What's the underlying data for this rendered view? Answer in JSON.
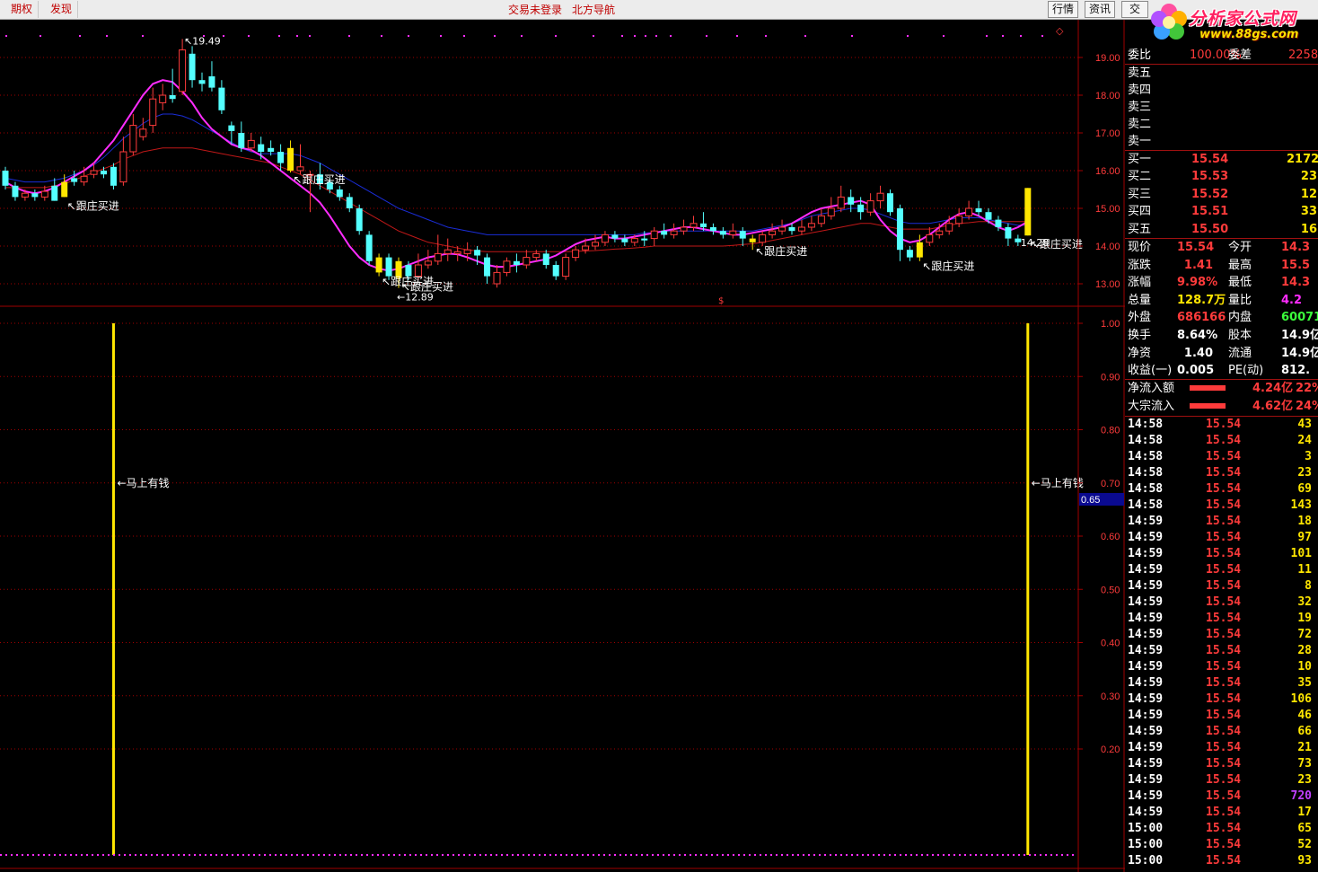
{
  "toolbar": {
    "left_tabs": [
      "期权",
      "发现"
    ],
    "center_links": [
      "交易未登录",
      "北方导航"
    ],
    "right_buttons": [
      "行情",
      "资讯",
      "交"
    ]
  },
  "logo": {
    "title": "分析家公式网",
    "url": "www.88gs.com"
  },
  "colors": {
    "up": "#ff3b3b",
    "down": "#54ffff",
    "signal": "#ffe600",
    "ma_short": "#ff2cff",
    "ma_mid": "#1a2dd8",
    "ma_long": "#c01818",
    "grid": "#a00000"
  },
  "price_axis": {
    "labels": [
      "19.00",
      "18.00",
      "17.00",
      "16.00",
      "15.00",
      "14.00",
      "13.00"
    ]
  },
  "indicator_axis": {
    "labels": [
      "1.00",
      "0.90",
      "0.80",
      "0.70",
      "0.60",
      "0.50",
      "0.40",
      "0.30",
      "0.20"
    ],
    "current_value": "0.65"
  },
  "chart_data": {
    "type": "candlestick",
    "high_label": "19.49",
    "low_label": "12.89",
    "last_label": "14.28",
    "signal_text": "跟庄买进",
    "indicator_text": "马上有钱",
    "candles": [
      [
        16.0,
        15.6,
        16.1,
        15.5
      ],
      [
        15.6,
        15.3,
        15.7,
        15.2
      ],
      [
        15.3,
        15.4,
        15.5,
        15.2
      ],
      [
        15.4,
        15.3,
        15.5,
        15.2
      ],
      [
        15.3,
        15.45,
        15.6,
        15.2
      ],
      [
        15.6,
        15.2,
        15.8,
        15.2
      ],
      [
        15.3,
        15.7,
        15.9,
        15.3
      ],
      [
        15.8,
        15.7,
        16.0,
        15.6
      ],
      [
        15.7,
        15.85,
        16.1,
        15.6
      ],
      [
        15.9,
        16.0,
        16.2,
        15.8
      ],
      [
        16.0,
        15.9,
        16.1,
        15.8
      ],
      [
        16.1,
        15.6,
        16.2,
        15.5
      ],
      [
        15.7,
        16.5,
        16.9,
        15.6
      ],
      [
        16.5,
        17.2,
        17.5,
        16.4
      ],
      [
        16.9,
        17.1,
        17.4,
        16.8
      ],
      [
        17.2,
        17.9,
        18.2,
        17.0
      ],
      [
        17.8,
        18.0,
        18.3,
        17.6
      ],
      [
        18.0,
        17.9,
        18.7,
        17.8
      ],
      [
        18.1,
        19.2,
        19.49,
        18.0
      ],
      [
        19.1,
        18.4,
        19.3,
        18.2
      ],
      [
        18.4,
        18.3,
        18.6,
        18.1
      ],
      [
        18.5,
        18.2,
        18.9,
        18.1
      ],
      [
        18.2,
        17.6,
        18.4,
        17.5
      ],
      [
        17.2,
        17.05,
        17.3,
        16.7
      ],
      [
        17.0,
        16.6,
        17.3,
        16.5
      ],
      [
        16.6,
        16.8,
        17.0,
        16.5
      ],
      [
        16.7,
        16.5,
        16.9,
        16.3
      ],
      [
        16.6,
        16.5,
        16.8,
        16.4
      ],
      [
        16.5,
        16.2,
        16.7,
        16.0
      ],
      [
        16.6,
        16.0,
        16.8,
        15.95
      ],
      [
        16.0,
        16.1,
        16.7,
        15.9
      ],
      [
        15.9,
        15.9,
        16.0,
        14.9
      ],
      [
        15.9,
        15.65,
        16.2,
        15.5
      ],
      [
        15.7,
        15.5,
        15.8,
        15.4
      ],
      [
        15.5,
        15.3,
        15.6,
        15.2
      ],
      [
        15.3,
        15.0,
        15.4,
        14.9
      ],
      [
        15.0,
        14.4,
        15.1,
        14.3
      ],
      [
        14.3,
        13.6,
        14.4,
        13.5
      ],
      [
        13.7,
        13.3,
        13.8,
        13.2
      ],
      [
        13.7,
        13.2,
        13.8,
        13.1
      ],
      [
        13.6,
        13.15,
        13.7,
        12.89
      ],
      [
        13.5,
        13.2,
        13.6,
        13.1
      ],
      [
        13.2,
        13.5,
        13.8,
        13.1
      ],
      [
        13.5,
        13.6,
        13.9,
        13.4
      ],
      [
        13.6,
        13.8,
        14.3,
        13.5
      ],
      [
        13.8,
        13.9,
        14.2,
        13.6
      ],
      [
        13.8,
        13.85,
        14.0,
        13.6
      ],
      [
        13.8,
        13.9,
        14.1,
        13.6
      ],
      [
        13.9,
        13.75,
        14.0,
        13.5
      ],
      [
        13.7,
        13.2,
        13.8,
        13.0
      ],
      [
        13.0,
        13.3,
        13.5,
        12.9
      ],
      [
        13.3,
        13.6,
        13.7,
        13.2
      ],
      [
        13.6,
        13.5,
        13.8,
        13.3
      ],
      [
        13.5,
        13.7,
        13.9,
        13.4
      ],
      [
        13.7,
        13.8,
        13.9,
        13.6
      ],
      [
        13.8,
        13.5,
        13.9,
        13.4
      ],
      [
        13.5,
        13.2,
        13.6,
        13.1
      ],
      [
        13.2,
        13.7,
        13.8,
        13.1
      ],
      [
        13.7,
        13.9,
        14.0,
        13.6
      ],
      [
        13.9,
        14.0,
        14.2,
        13.8
      ],
      [
        14.0,
        14.1,
        14.3,
        13.9
      ],
      [
        14.1,
        14.3,
        14.4,
        14.0
      ],
      [
        14.3,
        14.2,
        14.4,
        14.1
      ],
      [
        14.2,
        14.1,
        14.3,
        14.0
      ],
      [
        14.1,
        14.2,
        14.3,
        14.0
      ],
      [
        14.2,
        14.15,
        14.4,
        14.0
      ],
      [
        14.2,
        14.4,
        14.5,
        14.0
      ],
      [
        14.4,
        14.3,
        14.6,
        14.2
      ],
      [
        14.3,
        14.4,
        14.6,
        14.2
      ],
      [
        14.4,
        14.5,
        14.7,
        14.3
      ],
      [
        14.5,
        14.6,
        14.8,
        14.4
      ],
      [
        14.6,
        14.5,
        14.9,
        14.4
      ],
      [
        14.5,
        14.4,
        14.6,
        14.3
      ],
      [
        14.4,
        14.3,
        14.5,
        14.2
      ],
      [
        14.3,
        14.4,
        14.6,
        14.2
      ],
      [
        14.4,
        14.2,
        14.5,
        14.0
      ],
      [
        14.2,
        14.1,
        14.3,
        13.9
      ],
      [
        14.1,
        14.3,
        14.4,
        14.0
      ],
      [
        14.3,
        14.4,
        14.6,
        14.2
      ],
      [
        14.4,
        14.5,
        14.7,
        14.3
      ],
      [
        14.5,
        14.4,
        14.6,
        14.3
      ],
      [
        14.4,
        14.5,
        14.7,
        14.3
      ],
      [
        14.5,
        14.6,
        14.8,
        14.4
      ],
      [
        14.6,
        14.8,
        15.0,
        14.5
      ],
      [
        14.8,
        15.0,
        15.3,
        14.7
      ],
      [
        15.0,
        15.3,
        15.6,
        14.9
      ],
      [
        15.3,
        15.1,
        15.5,
        14.9
      ],
      [
        15.1,
        14.9,
        15.3,
        14.7
      ],
      [
        14.9,
        15.2,
        15.4,
        14.8
      ],
      [
        15.2,
        15.4,
        15.6,
        15.0
      ],
      [
        15.4,
        14.9,
        15.5,
        14.8
      ],
      [
        15.0,
        13.9,
        15.1,
        13.6
      ],
      [
        13.9,
        13.7,
        14.0,
        13.6
      ],
      [
        13.7,
        14.1,
        14.3,
        13.6
      ],
      [
        14.1,
        14.3,
        14.5,
        14.0
      ],
      [
        14.3,
        14.4,
        14.6,
        14.2
      ],
      [
        14.4,
        14.6,
        14.8,
        14.3
      ],
      [
        14.6,
        14.8,
        15.0,
        14.5
      ],
      [
        14.8,
        15.0,
        15.2,
        14.7
      ],
      [
        15.0,
        14.9,
        15.2,
        14.8
      ],
      [
        14.9,
        14.7,
        15.0,
        14.6
      ],
      [
        14.7,
        14.5,
        14.8,
        14.4
      ],
      [
        14.5,
        14.2,
        14.6,
        14.0
      ],
      [
        14.2,
        14.1,
        14.3,
        14.0
      ],
      [
        14.28,
        15.54,
        15.54,
        14.28
      ]
    ],
    "ma_short": [
      15.7,
      15.55,
      15.45,
      15.4,
      15.45,
      15.55,
      15.7,
      15.85,
      16.0,
      16.2,
      16.5,
      16.8,
      17.2,
      17.6,
      18.0,
      18.3,
      18.4,
      18.35,
      18.1,
      17.8,
      17.4,
      17.1,
      16.9,
      16.7,
      16.6,
      16.55,
      16.4,
      16.2,
      16.0,
      15.8,
      15.6,
      15.4,
      15.15,
      14.8,
      14.4,
      14.0,
      13.7,
      13.5,
      13.4,
      13.35,
      13.4,
      13.5,
      13.6,
      13.7,
      13.75,
      13.8,
      13.78,
      13.7,
      13.6,
      13.5,
      13.45,
      13.45,
      13.5,
      13.55,
      13.6,
      13.65,
      13.75,
      13.9,
      14.05,
      14.15,
      14.2,
      14.25,
      14.2,
      14.2,
      14.25,
      14.3,
      14.35,
      14.4,
      14.45,
      14.5,
      14.5,
      14.45,
      14.4,
      14.35,
      14.3,
      14.3,
      14.35,
      14.4,
      14.45,
      14.5,
      14.6,
      14.75,
      14.9,
      15.0,
      15.05,
      15.1,
      15.15,
      15.2,
      15.1,
      14.7,
      14.4,
      14.2,
      14.1,
      14.15,
      14.3,
      14.5,
      14.7,
      14.85,
      14.9,
      14.8,
      14.65,
      14.5,
      14.4,
      14.5,
      14.65
    ],
    "ma_mid": [
      15.8,
      15.75,
      15.7,
      15.7,
      15.7,
      15.75,
      15.8,
      15.9,
      16.0,
      16.15,
      16.35,
      16.6,
      16.85,
      17.05,
      17.25,
      17.4,
      17.5,
      17.5,
      17.45,
      17.35,
      17.2,
      17.05,
      16.9,
      16.75,
      16.6,
      16.5,
      16.45,
      16.45,
      16.45,
      16.45,
      16.4,
      16.3,
      16.2,
      16.05,
      15.9,
      15.75,
      15.6,
      15.45,
      15.3,
      15.15,
      15.0,
      14.9,
      14.8,
      14.7,
      14.6,
      14.5,
      14.45,
      14.4,
      14.35,
      14.3,
      14.3,
      14.3,
      14.3,
      14.3,
      14.3,
      14.3,
      14.3,
      14.3,
      14.3,
      14.3,
      14.3,
      14.3,
      14.3,
      14.3,
      14.3,
      14.35,
      14.35,
      14.4,
      14.4,
      14.4,
      14.4,
      14.4,
      14.4,
      14.4,
      14.4,
      14.4,
      14.4,
      14.45,
      14.5,
      14.55,
      14.6,
      14.7,
      14.8,
      14.85,
      14.9,
      14.95,
      15.0,
      15.0,
      14.95,
      14.85,
      14.75,
      14.65,
      14.6,
      14.6,
      14.6,
      14.65,
      14.7,
      14.75,
      14.75,
      14.75,
      14.7,
      14.65,
      14.6,
      14.55,
      14.55
    ],
    "ma_long": [
      15.55,
      15.55,
      15.55,
      15.55,
      15.55,
      15.6,
      15.65,
      15.75,
      15.85,
      15.95,
      16.05,
      16.15,
      16.3,
      16.4,
      16.5,
      16.55,
      16.6,
      16.6,
      16.6,
      16.6,
      16.55,
      16.5,
      16.45,
      16.4,
      16.35,
      16.3,
      16.25,
      16.2,
      16.1,
      16.0,
      15.9,
      15.75,
      15.6,
      15.45,
      15.3,
      15.15,
      15.0,
      14.85,
      14.7,
      14.55,
      14.4,
      14.3,
      14.2,
      14.1,
      14.05,
      14.0,
      13.95,
      13.9,
      13.87,
      13.85,
      13.85,
      13.85,
      13.85,
      13.85,
      13.85,
      13.85,
      13.85,
      13.85,
      13.86,
      13.87,
      13.88,
      13.9,
      13.92,
      13.93,
      13.95,
      13.97,
      14.0,
      14.0,
      14.0,
      14.0,
      14.0,
      14.0,
      14.0,
      14.0,
      14.02,
      14.04,
      14.06,
      14.1,
      14.15,
      14.2,
      14.25,
      14.3,
      14.35,
      14.4,
      14.45,
      14.5,
      14.55,
      14.6,
      14.6,
      14.55,
      14.5,
      14.45,
      14.45,
      14.45,
      14.45,
      14.5,
      14.55,
      14.6,
      14.62,
      14.65,
      14.65,
      14.65,
      14.65,
      14.65,
      14.65
    ],
    "signal_candles": [
      6,
      29,
      38,
      40,
      76,
      93,
      104
    ],
    "indicator_bars": [
      1,
      0.0
    ]
  },
  "quote": {
    "weibi": {
      "label": "委比",
      "value": "100.00%",
      "label2": "委差",
      "value2": "2258"
    },
    "sell": [
      {
        "label": "卖五"
      },
      {
        "label": "卖四"
      },
      {
        "label": "卖三"
      },
      {
        "label": "卖二"
      },
      {
        "label": "卖一"
      }
    ],
    "buy": [
      {
        "label": "买一",
        "price": "15.54",
        "vol": "2172"
      },
      {
        "label": "买二",
        "price": "15.53",
        "vol": "23"
      },
      {
        "label": "买三",
        "price": "15.52",
        "vol": "12"
      },
      {
        "label": "买四",
        "price": "15.51",
        "vol": "33"
      },
      {
        "label": "买五",
        "price": "15.50",
        "vol": "16"
      }
    ],
    "stats": [
      {
        "l1": "现价",
        "v1": "15.54",
        "l2": "今开",
        "v2": "14.3",
        "c1": "#ff3b3b",
        "c2": "#ff3b3b"
      },
      {
        "l1": "涨跌",
        "v1": "1.41",
        "l2": "最高",
        "v2": "15.5",
        "c1": "#ff3b3b",
        "c2": "#ff3b3b"
      },
      {
        "l1": "涨幅",
        "v1": "9.98%",
        "l2": "最低",
        "v2": "14.3",
        "c1": "#ff3b3b",
        "c2": "#ff3b3b"
      },
      {
        "l1": "总量",
        "v1": "128.7万",
        "l2": "量比",
        "v2": "4.2",
        "c1": "#ffe600",
        "c2": "#ff2cff"
      },
      {
        "l1": "外盘",
        "v1": "686166",
        "l2": "内盘",
        "v2": "60071",
        "c1": "#ff3b3b",
        "c2": "#3bff3b"
      },
      {
        "l1": "换手",
        "v1": "8.64%",
        "l2": "股本",
        "v2": "14.9亿",
        "c1": "#ffffff",
        "c2": "#ffffff"
      },
      {
        "l1": "净资",
        "v1": "1.40",
        "l2": "流通",
        "v2": "14.9亿",
        "c1": "#ffffff",
        "c2": "#ffffff"
      },
      {
        "l1": "收益(一)",
        "v1": "0.005",
        "l2": "PE(动)",
        "v2": "812.",
        "c1": "#ffffff",
        "c2": "#ffffff"
      }
    ],
    "flows": [
      {
        "label": "净流入额",
        "value": "4.24亿",
        "pct": "22%"
      },
      {
        "label": "大宗流入",
        "value": "4.62亿",
        "pct": "24%"
      }
    ]
  },
  "ticks": [
    [
      "14:58",
      "15.54",
      "43"
    ],
    [
      "14:58",
      "15.54",
      "24"
    ],
    [
      "14:58",
      "15.54",
      "3"
    ],
    [
      "14:58",
      "15.54",
      "23"
    ],
    [
      "14:58",
      "15.54",
      "69"
    ],
    [
      "14:58",
      "15.54",
      "143"
    ],
    [
      "14:59",
      "15.54",
      "18"
    ],
    [
      "14:59",
      "15.54",
      "97"
    ],
    [
      "14:59",
      "15.54",
      "101"
    ],
    [
      "14:59",
      "15.54",
      "11"
    ],
    [
      "14:59",
      "15.54",
      "8"
    ],
    [
      "14:59",
      "15.54",
      "32"
    ],
    [
      "14:59",
      "15.54",
      "19"
    ],
    [
      "14:59",
      "15.54",
      "72"
    ],
    [
      "14:59",
      "15.54",
      "28"
    ],
    [
      "14:59",
      "15.54",
      "10"
    ],
    [
      "14:59",
      "15.54",
      "35"
    ],
    [
      "14:59",
      "15.54",
      "106"
    ],
    [
      "14:59",
      "15.54",
      "46"
    ],
    [
      "14:59",
      "15.54",
      "66"
    ],
    [
      "14:59",
      "15.54",
      "21"
    ],
    [
      "14:59",
      "15.54",
      "73"
    ],
    [
      "14:59",
      "15.54",
      "23"
    ],
    [
      "14:59",
      "15.54",
      "720"
    ],
    [
      "14:59",
      "15.54",
      "17"
    ],
    [
      "15:00",
      "15.54",
      "65"
    ],
    [
      "15:00",
      "15.54",
      "52"
    ],
    [
      "15:00",
      "15.54",
      "93"
    ]
  ]
}
